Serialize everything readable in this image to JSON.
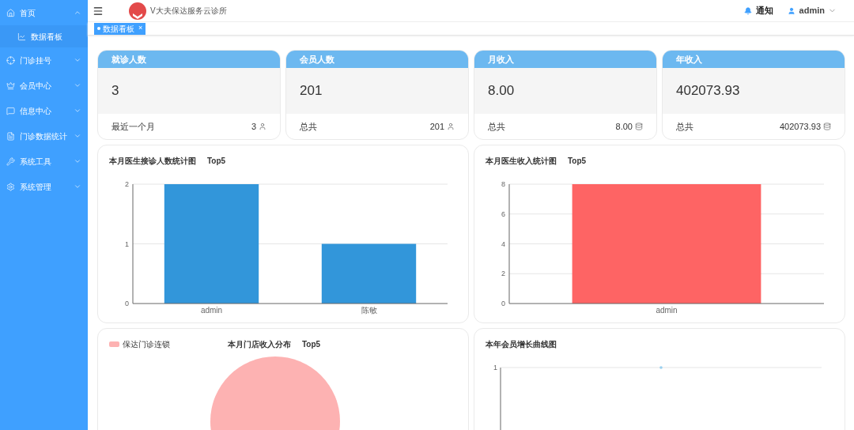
{
  "sidebar": {
    "items": [
      {
        "label": "首页",
        "expanded": true,
        "children": [
          {
            "label": "数据看板",
            "selected": true
          }
        ]
      },
      {
        "label": "门诊挂号",
        "expanded": false
      },
      {
        "label": "会员中心",
        "expanded": false
      },
      {
        "label": "信息中心",
        "expanded": false
      },
      {
        "label": "门诊数据统计",
        "expanded": false
      },
      {
        "label": "系统工具",
        "expanded": false
      },
      {
        "label": "系统管理",
        "expanded": false
      }
    ]
  },
  "header": {
    "title": "V大夫保达服务云诊所",
    "notice": "通知",
    "user": "admin"
  },
  "tabs": [
    {
      "label": "数据看板",
      "selected": true,
      "close": "×"
    }
  ],
  "stats": [
    {
      "title": "就诊人数",
      "value": "3",
      "footer_label": "最近一个月",
      "footer_value": "3",
      "kind": "user"
    },
    {
      "title": "会员人数",
      "value": "201",
      "footer_label": "总共",
      "footer_value": "201",
      "kind": "user"
    },
    {
      "title": "月收入",
      "value": "8.00",
      "footer_label": "总共",
      "footer_value": "8.00",
      "kind": "coin"
    },
    {
      "title": "年收入",
      "value": "402073.93",
      "footer_label": "总共",
      "footer_value": "402073.93",
      "kind": "coin"
    }
  ],
  "charts": [
    {
      "title": "本月医生接诊人数统计图",
      "suffix": "Top5",
      "chart_data": {
        "type": "bar",
        "categories": [
          "admin",
          "陈敏"
        ],
        "series": [
          {
            "color": "#3296da",
            "values": [
              2,
              1
            ]
          }
        ],
        "ylim": [
          0,
          2
        ],
        "yticks": [
          0,
          1,
          2
        ],
        "grid": true
      }
    },
    {
      "title": "本月医生收入统计图",
      "suffix": "Top5",
      "chart_data": {
        "type": "bar",
        "categories": [
          "admin"
        ],
        "series": [
          {
            "color": "#fe6464",
            "values": [
              8
            ]
          }
        ],
        "ylim": [
          0,
          8
        ],
        "yticks": [
          0,
          2,
          4,
          6,
          8
        ],
        "grid": true
      }
    }
  ],
  "pie_panel": {
    "title": "本月门店收入分布",
    "suffix": "Top5",
    "legend": [
      {
        "label": "保达门诊连锁",
        "color": "#fdb2b2"
      }
    ]
  },
  "line_panel": {
    "title": "本年会员增长曲线图",
    "y_tick_label": "1"
  }
}
